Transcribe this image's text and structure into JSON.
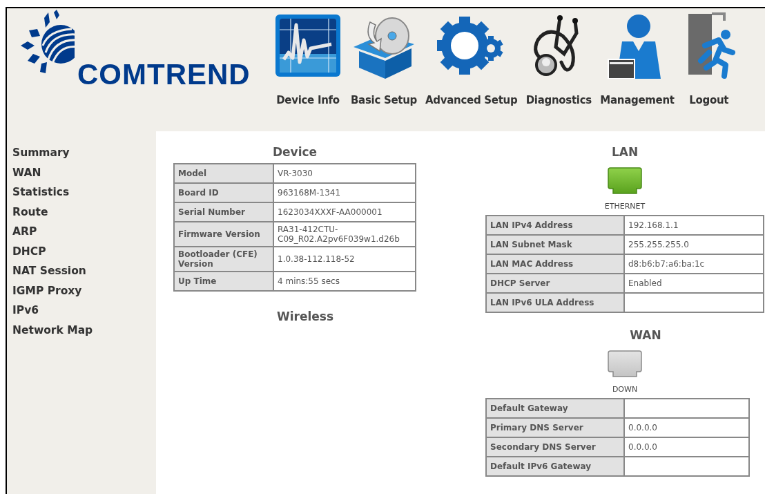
{
  "logo": {
    "text": "COMTREND"
  },
  "nav": [
    {
      "label": "Device Info",
      "kind": "device"
    },
    {
      "label": "Basic Setup",
      "kind": "basic"
    },
    {
      "label": "Advanced Setup",
      "kind": "advanced"
    },
    {
      "label": "Diagnostics",
      "kind": "diagnostics"
    },
    {
      "label": "Management",
      "kind": "management"
    },
    {
      "label": "Logout",
      "kind": "logout"
    }
  ],
  "sidebar": {
    "items": [
      "Summary",
      "WAN",
      "Statistics",
      "Route",
      "ARP",
      "DHCP",
      "NAT Session",
      "IGMP Proxy",
      "IPv6",
      "Network Map"
    ]
  },
  "device": {
    "title": "Device",
    "rows": [
      {
        "label": "Model",
        "value": "VR-3030"
      },
      {
        "label": "Board ID",
        "value": "963168M-1341"
      },
      {
        "label": "Serial Number",
        "value": "1623034XXXF-AA000001"
      },
      {
        "label": "Firmware Version",
        "value": "RA31-412CTU-C09_R02.A2pv6F039w1.d26b"
      },
      {
        "label": "Bootloader (CFE) Version",
        "value": "1.0.38-112.118-52"
      },
      {
        "label": "Up Time",
        "value": "4 mins:55 secs"
      }
    ]
  },
  "wireless": {
    "title": "Wireless"
  },
  "lan": {
    "title": "LAN",
    "port": {
      "connected": true,
      "status": "ETHERNET"
    },
    "rows": [
      {
        "label": "LAN IPv4 Address",
        "value": "192.168.1.1"
      },
      {
        "label": "LAN Subnet Mask",
        "value": "255.255.255.0"
      },
      {
        "label": "LAN MAC Address",
        "value": "d8:b6:b7:a6:ba:1c"
      },
      {
        "label": "DHCP Server",
        "value": "Enabled"
      },
      {
        "label": "LAN IPv6 ULA Address"
      }
    ]
  },
  "wan": {
    "title": "WAN",
    "port": {
      "connected": false,
      "status": "DOWN"
    },
    "rows": [
      {
        "label": "Default Gateway"
      },
      {
        "label": "Primary DNS Server",
        "value": "0.0.0.0"
      },
      {
        "label": "Secondary DNS Server",
        "value": "0.0.0.0"
      },
      {
        "label": "Default IPv6 Gateway"
      }
    ]
  }
}
